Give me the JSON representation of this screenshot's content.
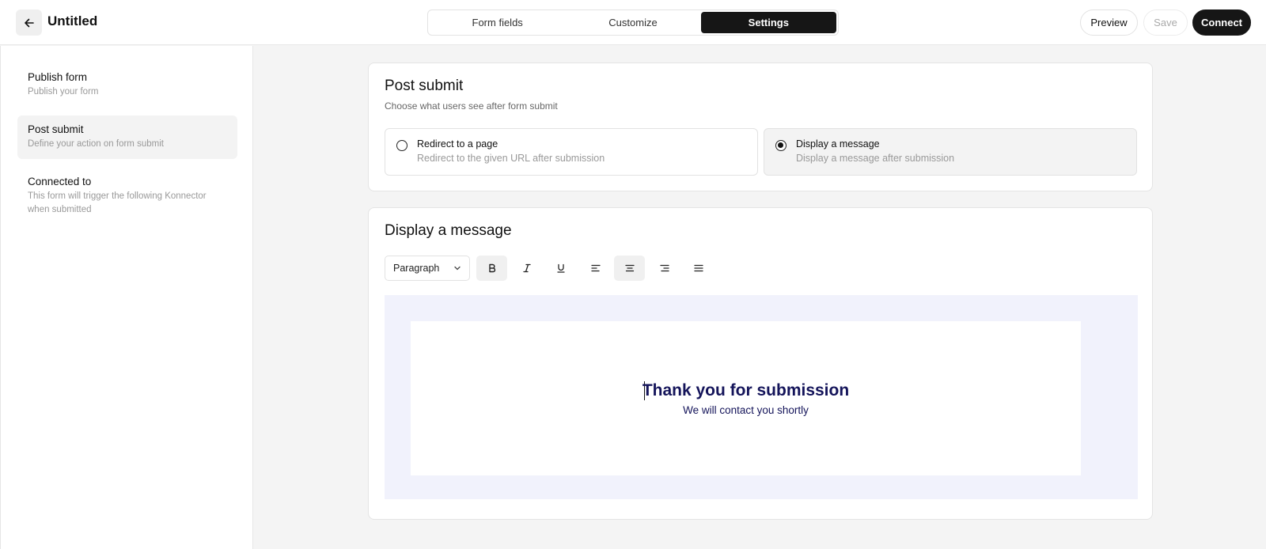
{
  "header": {
    "title": "Untitled",
    "tabs": [
      {
        "label": "Form fields",
        "active": false
      },
      {
        "label": "Customize",
        "active": false
      },
      {
        "label": "Settings",
        "active": true
      }
    ],
    "preview_label": "Preview",
    "save_label": "Save",
    "connect_label": "Connect"
  },
  "sidebar": {
    "items": [
      {
        "title": "Publish form",
        "desc": "Publish your form",
        "active": false
      },
      {
        "title": "Post submit",
        "desc": "Define your action on form submit",
        "active": true
      },
      {
        "title": "Connected to",
        "desc": "This form will trigger the following Konnector when submitted",
        "active": false
      }
    ]
  },
  "post_submit": {
    "title": "Post submit",
    "subtitle": "Choose what users see after form submit",
    "options": [
      {
        "title": "Redirect to a page",
        "desc": "Redirect to the given URL after submission",
        "selected": false
      },
      {
        "title": "Display a message",
        "desc": "Display a message after submission",
        "selected": true
      }
    ]
  },
  "display_message": {
    "title": "Display a message",
    "format_select": "Paragraph",
    "toolbar": [
      "bold-icon",
      "italic-icon",
      "underline-icon",
      "align-left-icon",
      "align-center-icon",
      "align-right-icon",
      "align-justify-icon"
    ],
    "active_tools": [
      "bold-icon",
      "align-center-icon"
    ],
    "message_title": "Thank you for submission",
    "message_subtitle": "We will contact you shortly"
  },
  "colors": {
    "accent_dark": "#161616",
    "message_text": "#14145a",
    "canvas_bg": "#f1f2fc"
  }
}
